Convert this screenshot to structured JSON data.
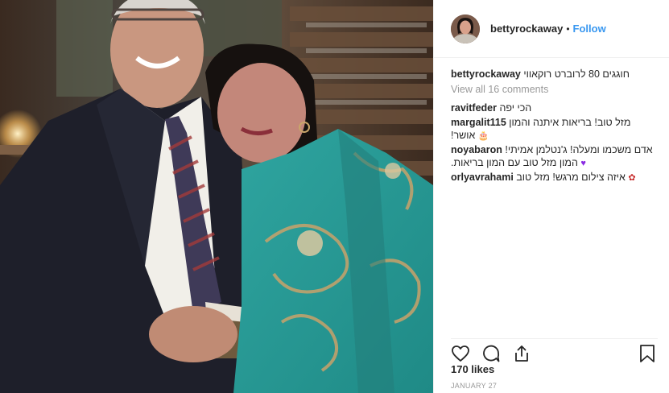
{
  "post": {
    "username": "bettyrockaway",
    "separator": "•",
    "follow_label": "Follow",
    "caption": {
      "username": "bettyrockaway",
      "text": "חוגגים 80 לרוברט רוקאווי"
    },
    "view_all_label": "View all 16 comments",
    "comments": [
      {
        "user": "ravitfeder",
        "text": "הכי יפה",
        "emoji": ""
      },
      {
        "user": "margalit115",
        "text": "מזל טוב! בריאות איתנה והמון אושר!",
        "emoji": "cake-icon"
      },
      {
        "user": "noyabaron",
        "text": "אדם משכמו ומעלה! ג'נטלמן אמיתי! המון מזל טוב עם המון בריאות.",
        "emoji": "heart-icon"
      },
      {
        "user": "orlyavrahami",
        "text": "איזה צילום מרגש! מזל טוב",
        "emoji": "rose-icon"
      }
    ],
    "likes_label": "170 likes",
    "date_label": "January 27",
    "icons": {
      "like": "heart-outline-icon",
      "comment": "comment-bubble-icon",
      "share": "share-icon",
      "save": "bookmark-icon"
    },
    "colors": {
      "follow": "#3897f0",
      "muted": "#999999",
      "text": "#262626",
      "heart_emoji": "#8a2be2"
    }
  }
}
